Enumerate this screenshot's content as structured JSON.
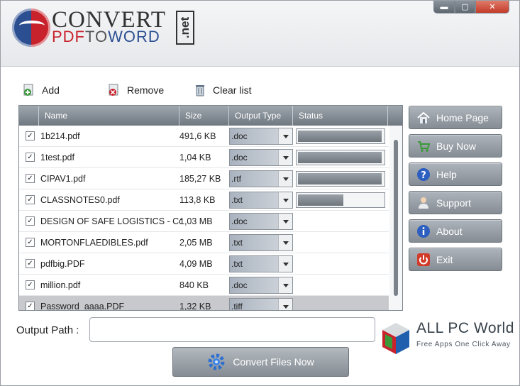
{
  "window": {
    "minimize_glyph": "▬",
    "maximize_glyph": "▢",
    "close_glyph": "✕"
  },
  "logo": {
    "line1": "CONVERT",
    "line2_a": "PDF",
    "line2_b": "TO",
    "line2_c": "WORD",
    "badge": ".net"
  },
  "toolbar": {
    "add": "Add",
    "remove": "Remove",
    "clear": "Clear list"
  },
  "table": {
    "columns": {
      "name": "Name",
      "size": "Size",
      "type": "Output Type",
      "status": "Status"
    },
    "rows": [
      {
        "name": "1b214.pdf",
        "size": "491,6 KB",
        "type": ".doc",
        "progress": 0.98
      },
      {
        "name": "1test.pdf",
        "size": "1,04 KB",
        "type": ".doc",
        "progress": 0.98
      },
      {
        "name": "CIPAV1.pdf",
        "size": "185,27 KB",
        "type": ".rtf",
        "progress": 0.98
      },
      {
        "name": "CLASSNOTES0.pdf",
        "size": "113,8 KB",
        "type": ".txt",
        "progress": 0.53
      },
      {
        "name": "DESIGN OF SAFE LOGISTICS - Copy.pdf",
        "size": "1,03 MB",
        "type": ".doc",
        "progress": null
      },
      {
        "name": "MORTONFLAEDIBLES.pdf",
        "size": "2,05 MB",
        "type": ".txt",
        "progress": null
      },
      {
        "name": "pdfbig.PDF",
        "size": "4,09 MB",
        "type": ".txt",
        "progress": null
      },
      {
        "name": "million.pdf",
        "size": "840 KB",
        "type": ".doc",
        "progress": null
      },
      {
        "name": "Password_aaaa.PDF",
        "size": "1,32 KB",
        "type": ".tiff",
        "progress": null
      }
    ]
  },
  "side": {
    "home": "Home Page",
    "buy": "Buy Now",
    "help": "Help",
    "support": "Support",
    "about": "About",
    "exit": "Exit"
  },
  "output": {
    "label": "Output Path :",
    "value": ""
  },
  "convert": {
    "label": "Convert Files Now"
  },
  "watermark": {
    "title": "ALL PC World",
    "subtitle": "Free Apps One Click Away"
  },
  "colors": {
    "brand_red": "#c8232c",
    "brand_blue": "#2c4f92",
    "header": "#6f7780",
    "button": "#858c94"
  }
}
